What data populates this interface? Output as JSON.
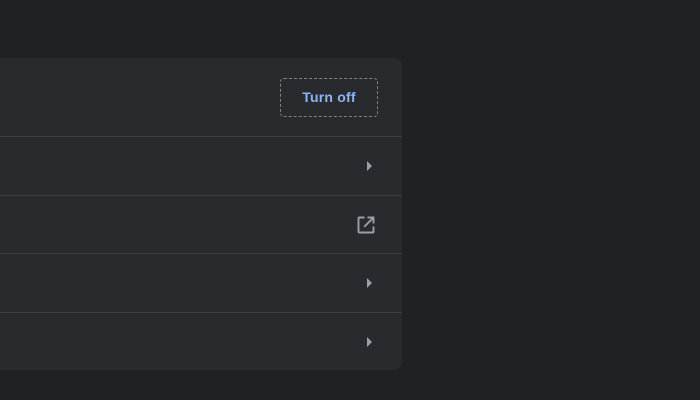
{
  "settings_card": {
    "sync_row": {
      "button_label": "Turn off"
    },
    "rows": [
      {
        "action_icon": "arrow-right-icon"
      },
      {
        "action_icon": "open-in-new-icon"
      },
      {
        "action_icon": "arrow-right-icon"
      },
      {
        "action_icon": "arrow-right-icon"
      }
    ]
  },
  "colors": {
    "page_background": "#202124",
    "card_background": "#292a2d",
    "divider": "#3c3d40",
    "accent": "#8ab4f8",
    "icon": "#9aa0a6"
  }
}
